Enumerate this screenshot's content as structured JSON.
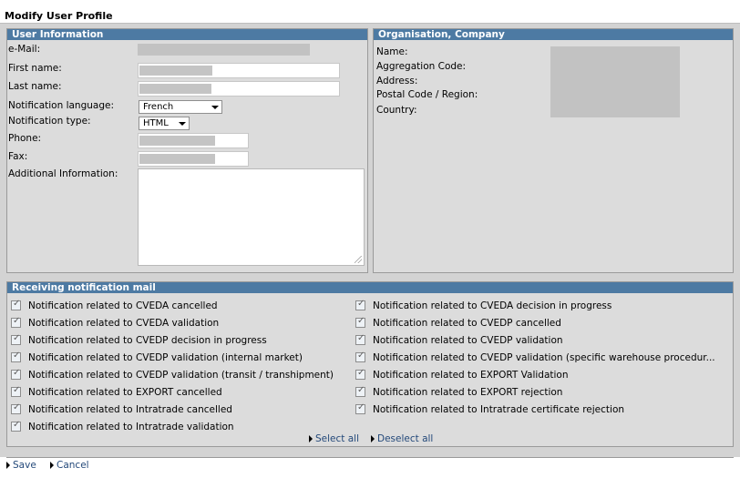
{
  "page": {
    "title": "Modify User Profile"
  },
  "user_info": {
    "heading": "User Information",
    "fields": {
      "email": "e-Mail:",
      "first_name": "First name:",
      "last_name": "Last name:",
      "notification_language": "Notification language:",
      "notification_type": "Notification type:",
      "phone": "Phone:",
      "fax": "Fax:",
      "additional_info": "Additional Information:"
    },
    "language_value": "French",
    "type_value": "HTML"
  },
  "organisation": {
    "heading": "Organisation, Company",
    "labels": [
      "Name:",
      "Aggregation Code:",
      "Address:",
      "Postal Code / Region:",
      "Country:"
    ]
  },
  "notifications": {
    "heading": "Receiving notification mail",
    "left": [
      "Notification related to CVEDA cancelled",
      "Notification related to CVEDA validation",
      "Notification related to CVEDP decision in progress",
      "Notification related to CVEDP validation (internal market)",
      "Notification related to CVEDP validation (transit / transhipment)",
      "Notification related to EXPORT cancelled",
      "Notification related to Intratrade cancelled",
      "Notification related to Intratrade validation"
    ],
    "right": [
      "Notification related to CVEDA decision in progress",
      "Notification related to CVEDP cancelled",
      "Notification related to CVEDP validation",
      "Notification related to CVEDP validation (specific warehouse procedur...",
      "Notification related to EXPORT Validation",
      "Notification related to EXPORT rejection",
      "Notification related to Intratrade certificate rejection"
    ],
    "select_all": "Select all",
    "deselect_all": "Deselect all"
  },
  "actions": {
    "save": "Save",
    "cancel": "Cancel"
  },
  "icons": {
    "checkbox": "checkbox-checked-icon",
    "arrow": "triangle-right-icon",
    "dropdown": "chevron-down-icon"
  }
}
